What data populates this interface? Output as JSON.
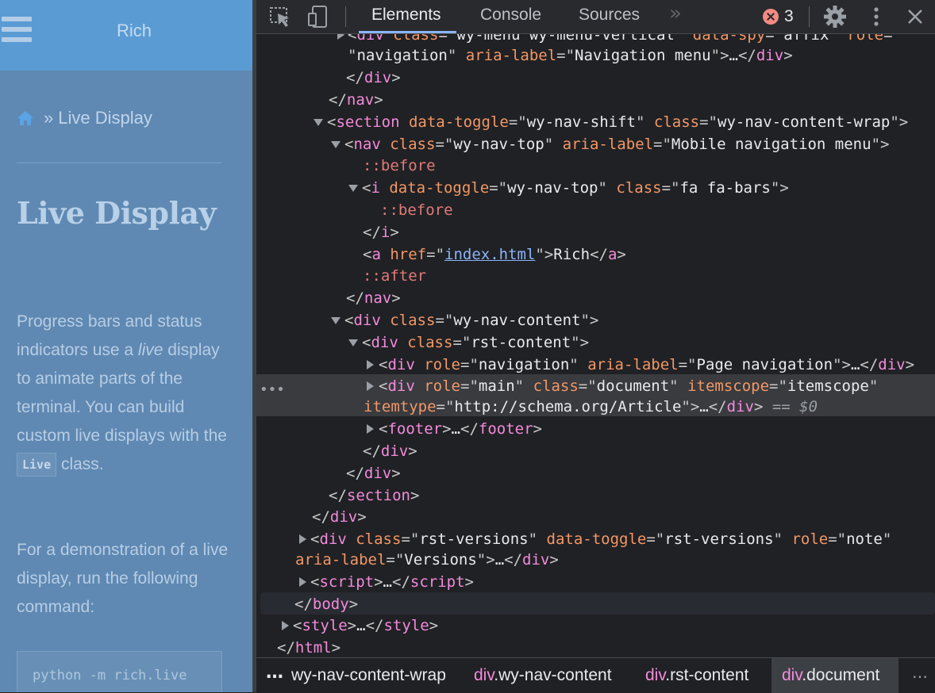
{
  "page": {
    "brand": "Rich",
    "breadcrumb_sep": "»",
    "breadcrumb_current": "Live Display",
    "title": "Live Display",
    "para1_before": "Progress bars and status indicators use a ",
    "para1_em": "live",
    "para1_after": " display to animate parts of the terminal. You can build custom live displays with the ",
    "para1_code": "Live",
    "para1_end": " class.",
    "para2": "For a demonstration of a live display, run the following command:",
    "code": "python -m rich.live"
  },
  "devtools": {
    "tabs": [
      "Elements",
      "Console",
      "Sources"
    ],
    "more_tabs": "»",
    "error_count": "3"
  },
  "tree": {
    "l0_tag": "div",
    "l0_a1": "class",
    "l0_v1": "wy-menu wy-menu-vertical",
    "l0_a2": "data-spy",
    "l0_v2": "affix",
    "l0_a3": "role",
    "l1_v": "navigation",
    "l1_a": "aria-label",
    "l1_v2": "Navigation menu",
    "l1_ell": "…",
    "l1_close": "div",
    "l2_close": "div",
    "l3_close": "nav",
    "l4_tag": "section",
    "l4_a1": "data-toggle",
    "l4_v1": "wy-nav-shift",
    "l4_a2": "class",
    "l4_v2": "wy-nav-content-wrap",
    "l5_tag": "nav",
    "l5_a1": "class",
    "l5_v1": "wy-nav-top",
    "l5_a2": "aria-label",
    "l5_v2": "Mobile navigation menu",
    "l6_pseudo": "::before",
    "l7_tag": "i",
    "l7_a1": "data-toggle",
    "l7_v1": "wy-nav-top",
    "l7_a2": "class",
    "l7_v2": "fa fa-bars",
    "l8_pseudo": "::before",
    "l9_close": "i",
    "l10_tag": "a",
    "l10_a1": "href",
    "l10_v1": "index.html",
    "l10_text": "Rich",
    "l10_close": "a",
    "l11_pseudo": "::after",
    "l12_close": "nav",
    "l13_tag": "div",
    "l13_a1": "class",
    "l13_v1": "wy-nav-content",
    "l14_tag": "div",
    "l14_a1": "class",
    "l14_v1": "rst-content",
    "l15_tag": "div",
    "l15_a1": "role",
    "l15_v1": "navigation",
    "l15_a2": "aria-label",
    "l15_v2": "Page navigation",
    "l15_ell": "…",
    "l15_close": "div",
    "l16_tag": "div",
    "l16_a1": "role",
    "l16_v1": "main",
    "l16_a2": "class",
    "l16_v2": "document",
    "l16_a3": "itemscope",
    "l16_v3": "itemscope",
    "l17_a": "itemtype",
    "l17_v": "http://schema.org/Article",
    "l17_ell": "…",
    "l17_close": "div",
    "l17_eq": "== $0",
    "l18_tag": "footer",
    "l18_ell": "…",
    "l18_close": "footer",
    "l19_close": "div",
    "l20_close": "div",
    "l21_close": "section",
    "l22_close": "div",
    "l23_tag": "div",
    "l23_a1": "class",
    "l23_v1": "rst-versions",
    "l23_a2": "data-toggle",
    "l23_v2": "rst-versions",
    "l23_a3": "role",
    "l23_v3": "note",
    "l24_a": "aria-label",
    "l24_v": "Versions",
    "l24_ell": "…",
    "l24_close": "div",
    "l25_tag": "script",
    "l25_ell": "…",
    "l25_close": "script",
    "l26_close": "body",
    "l27_tag": "style",
    "l27_ell": "…",
    "l27_close": "style",
    "l28_close": "html"
  },
  "crumbs": {
    "c1_text": "wy-nav-content-wrap",
    "c2_tag": "div",
    "c2_text": ".wy-nav-content",
    "c3_tag": "div",
    "c3_text": ".rst-content",
    "c4_tag": "div",
    "c4_text": ".document",
    "left_more": "…",
    "right_more": "…"
  },
  "colors": {
    "page_bg": "#5f89b3",
    "page_header": "#5a9bd4",
    "devtools_bg": "#202124",
    "tag_color": "#f28bdc",
    "attr_name": "#f29766",
    "selected_row": "#393b3f",
    "accent": "#8ab4f8"
  },
  "icons": [
    "hamburger-icon",
    "home-icon",
    "inspect-icon",
    "device-toggle-icon",
    "error-icon",
    "settings-gear-icon",
    "kebab-menu-icon",
    "close-icon"
  ]
}
